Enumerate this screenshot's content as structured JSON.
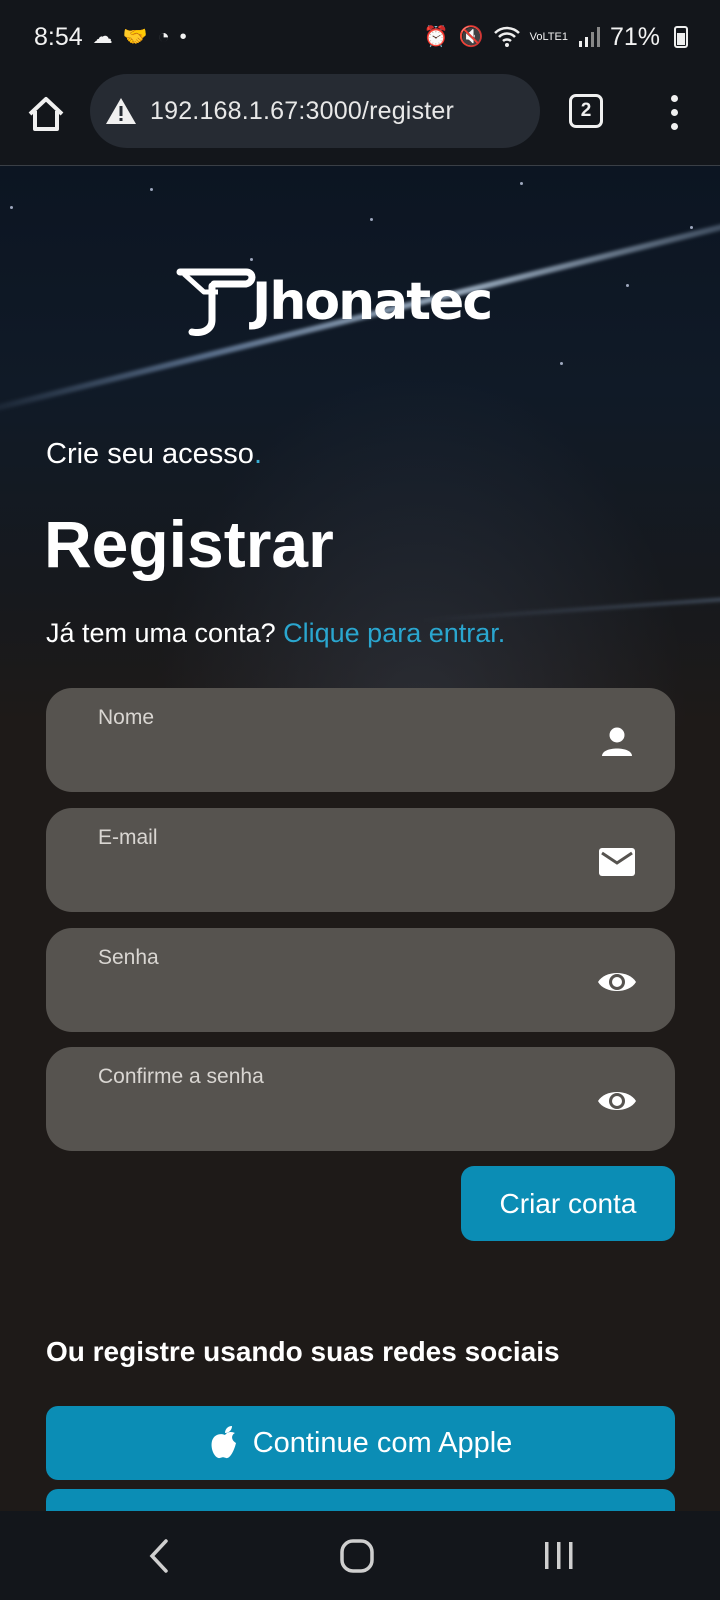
{
  "status_bar": {
    "time": "8:54",
    "left_icons": [
      "cloud-icon",
      "handshake-icon",
      "notification-icon",
      "dot-icon"
    ],
    "right_icons": [
      "alarm-icon",
      "mute-icon",
      "wifi-icon",
      "volte-icon",
      "signal-icon"
    ],
    "volte_label": "VoLTE1",
    "battery": "71%"
  },
  "browser": {
    "url": "192.168.1.67:3000/register",
    "tab_count": "2"
  },
  "brand": {
    "logo_text": "Jhonatec"
  },
  "register": {
    "subtitle": "Crie seu acesso",
    "subtitle_dot": ".",
    "title": "Registrar",
    "login_prompt": "Já tem uma conta?",
    "login_link": "Clique para entrar.",
    "fields": {
      "name": {
        "label": "Nome",
        "value": "",
        "icon": "person-icon"
      },
      "email": {
        "label": "E-mail",
        "value": "",
        "icon": "mail-icon"
      },
      "password": {
        "label": "Senha",
        "value": "",
        "icon": "eye-icon"
      },
      "confirm": {
        "label": "Confirme a senha",
        "value": "",
        "icon": "eye-icon"
      }
    },
    "submit_label": "Criar conta",
    "social_heading": "Ou registre usando suas redes sociais",
    "apple_label": "Continue com Apple"
  },
  "colors": {
    "accent": "#0b8db5",
    "link": "#2aa6cf",
    "field_bg": "#56534f",
    "page_bg": "#1e1a18",
    "bar_bg": "#13161b"
  }
}
